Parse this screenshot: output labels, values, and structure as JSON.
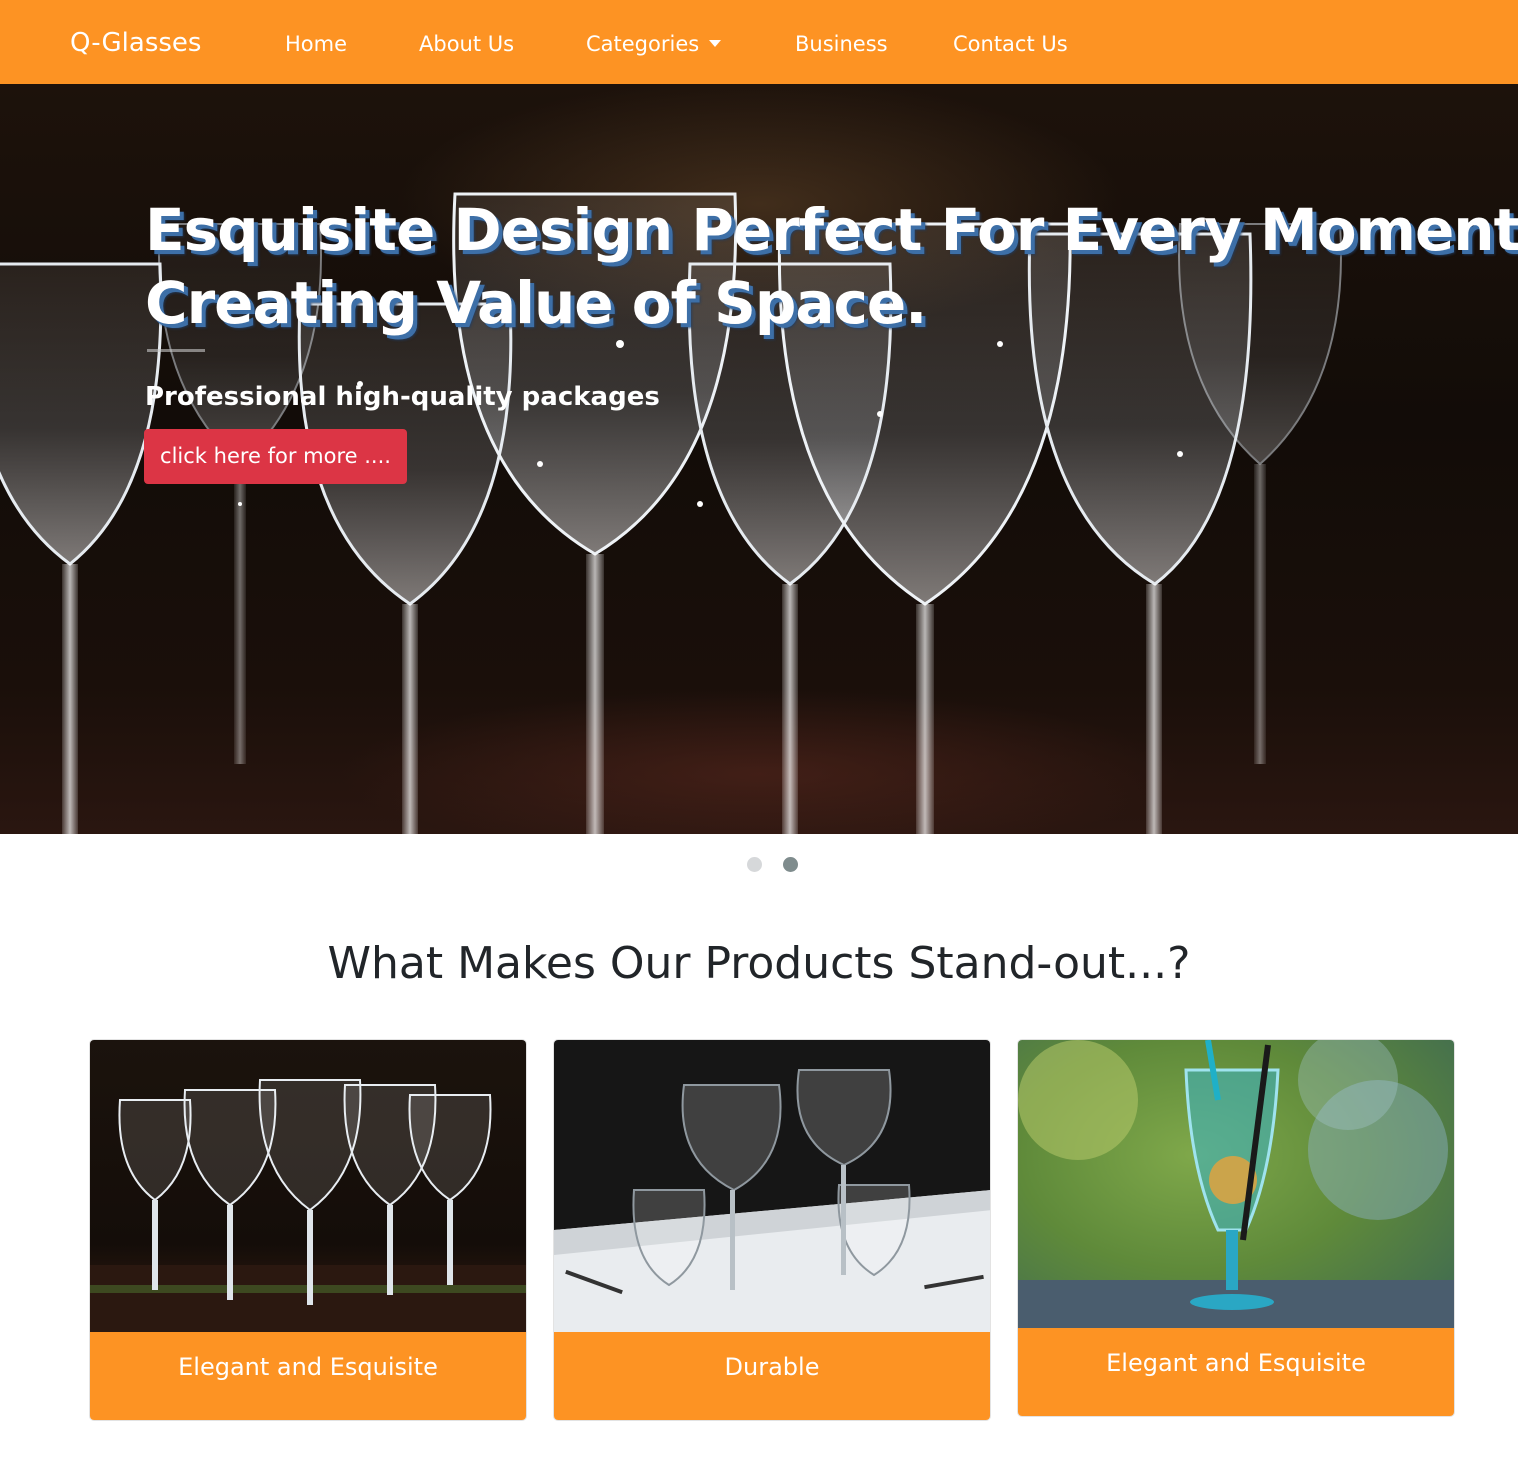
{
  "navbar": {
    "brand": "Q-Glasses",
    "links": [
      {
        "label": "Home"
      },
      {
        "label": "About Us"
      },
      {
        "label": "Categories",
        "has_dropdown": true
      },
      {
        "label": "Business"
      },
      {
        "label": "Contact Us"
      }
    ],
    "background_color": "#fd9323"
  },
  "hero": {
    "title_line1": "Esquisite Design Perfect For Every Moment",
    "title_line2": "Creating Value of Space.",
    "subtitle": "Professional high-quality packages",
    "button_label": "click here for more ....",
    "button_color": "#dc3545",
    "image": "crystal-wine-glasses-photo"
  },
  "carousel": {
    "slides": 2,
    "active_slide": 2
  },
  "features": {
    "title": "What Makes Our Products Stand-out...?",
    "cards": [
      {
        "label": "Elegant and Esquisite",
        "image": "crystal-glasses-on-table-photo"
      },
      {
        "label": "Durable",
        "image": "wine-glasses-on-white-tablecloth-photo"
      },
      {
        "label": "Elegant and Esquisite",
        "image": "blue-cocktail-glass-photo"
      }
    ]
  }
}
